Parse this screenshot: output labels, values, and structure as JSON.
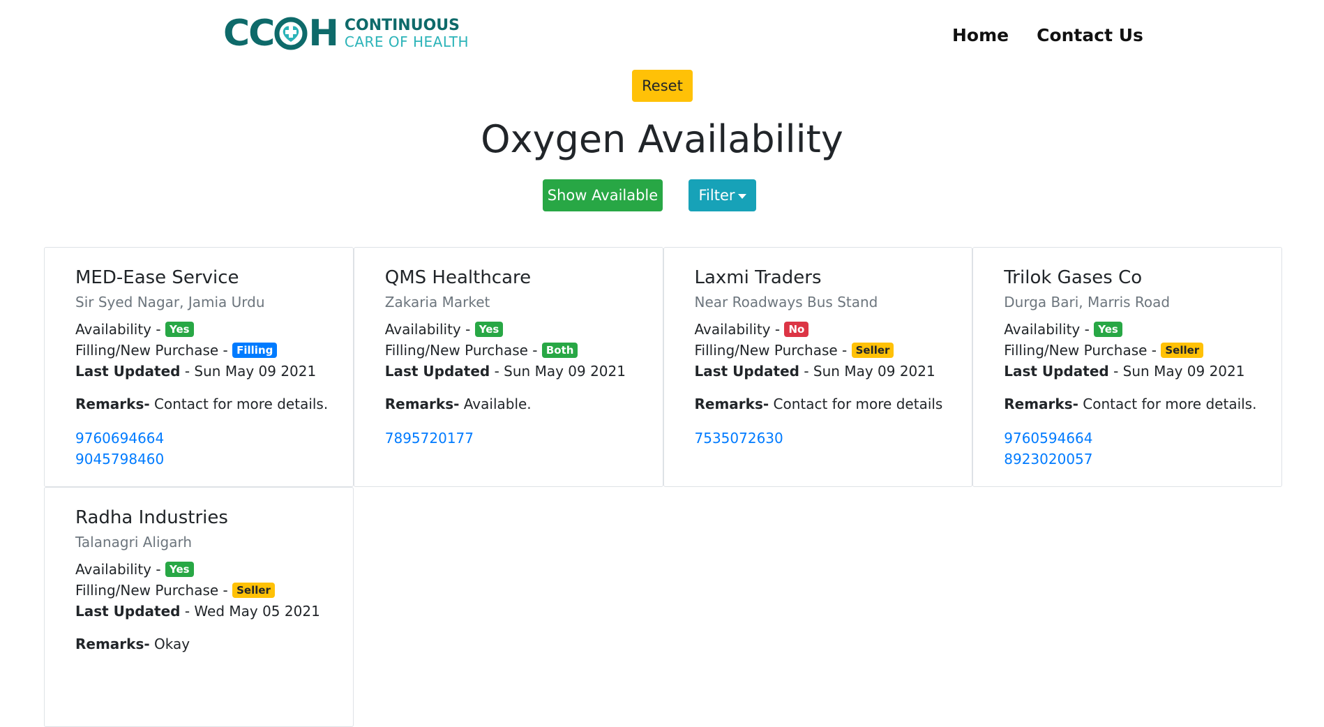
{
  "brand": {
    "letters_left": "CC",
    "letter_right": "H",
    "line1": "CONTINUOUS",
    "line2": "CARE OF HEALTH",
    "colors": {
      "dark": "#0e6a6a",
      "light": "#2bb3b8"
    }
  },
  "nav": {
    "home": "Home",
    "contact": "Contact Us"
  },
  "reset_label": "Reset",
  "title": "Oxygen Availability",
  "show_available_label": "Show Available",
  "filter_label": "Filter",
  "labels": {
    "availability": "Availability -",
    "filling": "Filling/New Purchase -",
    "last_updated": "Last Updated",
    "remarks": "Remarks-"
  },
  "cards": [
    {
      "name": "MED-Ease Service",
      "address": "Sir Syed Nagar, Jamia Urdu",
      "availability": "Yes",
      "filling": "Filling",
      "last_updated": " - Sun May 09 2021",
      "remarks": " Contact for more details.",
      "phones": [
        "9760694664",
        "9045798460"
      ]
    },
    {
      "name": "QMS Healthcare",
      "address": "Zakaria Market",
      "availability": "Yes",
      "filling": "Both",
      "last_updated": " - Sun May 09 2021",
      "remarks": " Available.",
      "phones": [
        "7895720177",
        ""
      ]
    },
    {
      "name": "Laxmi Traders",
      "address": "Near Roadways Bus Stand",
      "availability": "No",
      "filling": "Seller",
      "last_updated": " - Sun May 09 2021",
      "remarks": " Contact for more details",
      "phones": [
        "7535072630",
        ""
      ]
    },
    {
      "name": "Trilok Gases Co",
      "address": "Durga Bari, Marris Road",
      "availability": "Yes",
      "filling": "Seller",
      "last_updated": " - Sun May 09 2021",
      "remarks": " Contact for more details.",
      "phones": [
        "9760594664",
        "8923020057"
      ]
    },
    {
      "name": "Radha Industries",
      "address": "Talanagri Aligarh",
      "availability": "Yes",
      "filling": "Seller",
      "last_updated": " - Wed May 05 2021",
      "remarks": " Okay",
      "phones": [
        "",
        ""
      ]
    }
  ],
  "colors": {
    "yes": "#28a745",
    "no": "#dc3545",
    "filling": "#007bff",
    "seller_both": "#ffc107",
    "link": "#007bff"
  }
}
